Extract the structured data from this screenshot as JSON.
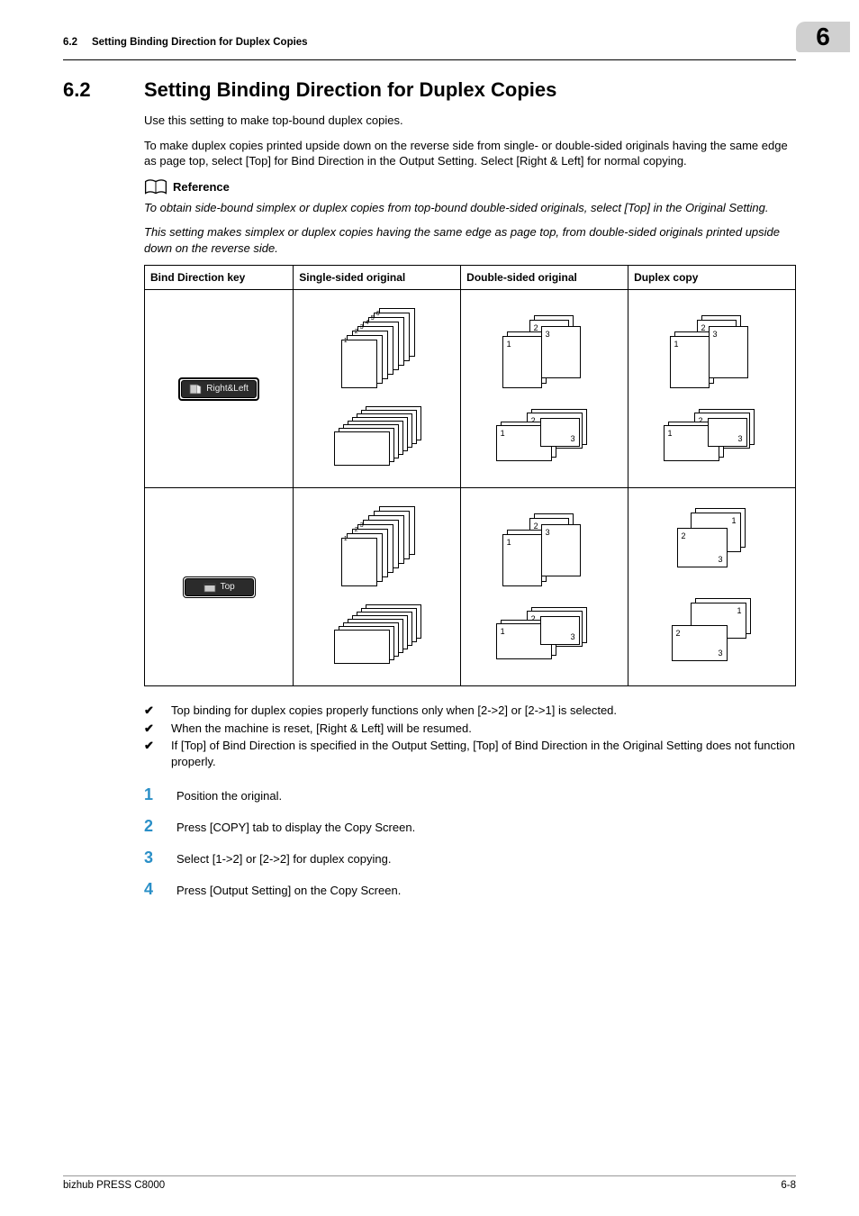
{
  "header": {
    "section_ref": "6.2",
    "section_title_short": "Setting Binding Direction for Duplex Copies",
    "chapter_num": "6"
  },
  "title": {
    "num": "6.2",
    "text": "Setting Binding Direction for Duplex Copies"
  },
  "intro": {
    "p1": "Use this setting to make top-bound duplex copies.",
    "p2": "To make duplex copies printed upside down on the reverse side from single- or double-sided originals having the same edge as page top, select [Top] for Bind Direction in the Output Setting. Select [Right & Left] for normal copying."
  },
  "reference": {
    "label": "Reference",
    "p1": "To obtain side-bound simplex or duplex copies from top-bound double-sided originals, select [Top] in the Original Setting.",
    "p2": "This setting makes simplex or duplex copies having the same edge as page top, from double-sided originals printed upside down on the reverse side."
  },
  "table": {
    "headers": [
      "Bind Direction key",
      "Single-sided original",
      "Double-sided original",
      "Duplex copy"
    ],
    "row1_key": "Right&Left",
    "row2_key": "Top"
  },
  "checks": {
    "c1": "Top binding for duplex copies properly functions only when [2->2] or [2->1] is selected.",
    "c2": "When the machine is reset, [Right & Left] will be resumed.",
    "c3": "If [Top] of Bind Direction is specified in the Output Setting, [Top] of Bind Direction in the Original Setting does not function properly."
  },
  "steps": {
    "s1": "Position the original.",
    "s2": "Press [COPY] tab to display the Copy Screen.",
    "s3": "Select [1->2] or [2->2] for duplex copying.",
    "s4": "Press [Output Setting] on the Copy Screen."
  },
  "footer": {
    "product": "bizhub PRESS C8000",
    "page": "6-8"
  }
}
